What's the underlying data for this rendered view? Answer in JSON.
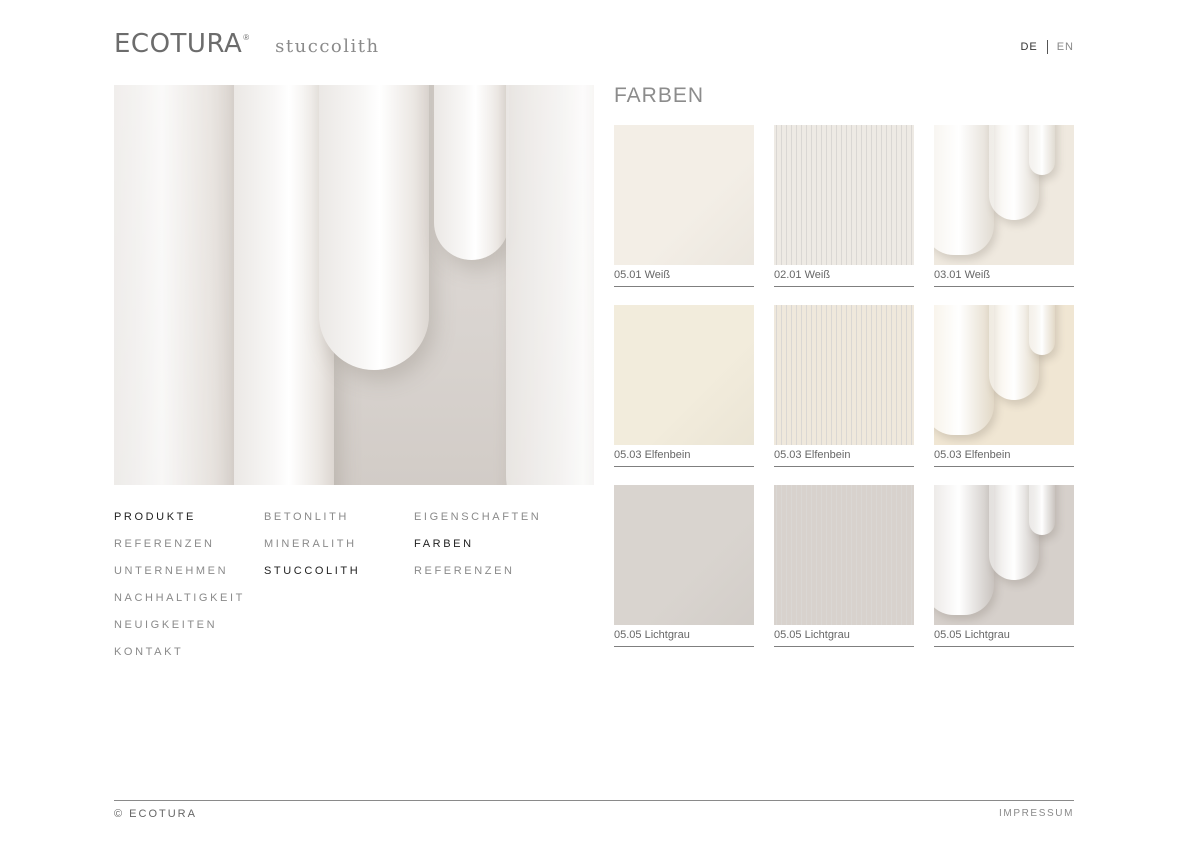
{
  "brand": {
    "name": "ECOTURA",
    "registered": "®",
    "product": "stuccolith"
  },
  "lang": {
    "active": "DE",
    "inactive": "EN"
  },
  "menu": {
    "col1": [
      "PRODUKTE",
      "REFERENZEN",
      "UNTERNEHMEN",
      "NACHHALTIGKEIT",
      "NEUIGKEITEN",
      "KONTAKT"
    ],
    "col2": [
      "BETONLITH",
      "MINERALITH",
      "STUCCOLITH"
    ],
    "col3": [
      "EIGENSCHAFTEN",
      "FARBEN",
      "REFERENZEN"
    ],
    "active": [
      "PRODUKTE",
      "STUCCOLITH",
      "FARBEN"
    ]
  },
  "section_title": "FARBEN",
  "swatches": [
    {
      "label": "05.01 Weiß",
      "texture": "flat",
      "color": "#f3eee6"
    },
    {
      "label": "02.01 Weiß",
      "texture": "stripe",
      "color": "#eeeae4"
    },
    {
      "label": "03.01 Weiß",
      "texture": "relief",
      "color": "#efe9df"
    },
    {
      "label": "05.03 Elfenbein",
      "texture": "flat",
      "color": "#f2ecdc"
    },
    {
      "label": "05.03 Elfenbein",
      "texture": "stripe",
      "color": "#efe8dc"
    },
    {
      "label": "05.03 Elfenbein",
      "texture": "relief",
      "color": "#f0e6d3"
    },
    {
      "label": "05.05 Lichtgrau",
      "texture": "flat",
      "color": "#d9d4cf"
    },
    {
      "label": "05.05 Lichtgrau",
      "texture": "stripe",
      "color": "#d8d2cd"
    },
    {
      "label": "05.05 Lichtgrau",
      "texture": "relief",
      "color": "#d6d0cb"
    }
  ],
  "footer": {
    "copyright": "© ECOTURA",
    "imprint": "IMPRESSUM"
  }
}
